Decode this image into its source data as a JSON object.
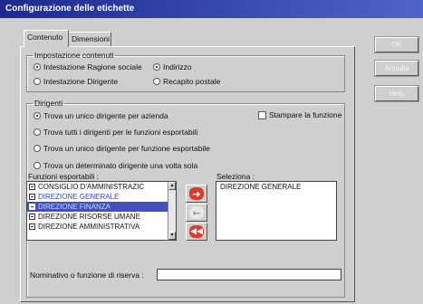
{
  "window": {
    "title": "Configurazione delle etichette"
  },
  "tabs": [
    {
      "label": "Contenuto"
    },
    {
      "label": "Dimensioni"
    }
  ],
  "impostazione": {
    "legend": "Impostazione contenuti",
    "options": [
      {
        "label": "Intestazione Ragione sociale",
        "checked": true
      },
      {
        "label": "Indirizzo",
        "checked": true
      },
      {
        "label": "Intestazione Dirigente",
        "checked": false
      },
      {
        "label": "Recapito postale",
        "checked": false
      }
    ]
  },
  "dirigenti": {
    "legend": "Dirigenti",
    "stampare_label": "Stampare la funzione",
    "stampare_checked": false,
    "options": [
      {
        "label": "Trova un unico dirigente per azienda",
        "checked": true
      },
      {
        "label": "Trova tutti i dirigenti per le funzioni esportabili",
        "checked": false
      },
      {
        "label": "Trova un unico dirigente per funzione esportabile",
        "checked": false
      },
      {
        "label": "Trova un determinato dirigente una volta sola",
        "checked": false
      }
    ],
    "funzioni_label": "Funzioni esportabili :",
    "funzioni_items": [
      {
        "label": "CONSIGLIO D'AMMINISTRAZIC",
        "state": "normal"
      },
      {
        "label": "DIREZIONE GENERALE",
        "state": "blue"
      },
      {
        "label": "DIREZIONE FINANZA",
        "state": "selected"
      },
      {
        "label": "DIREZIONE RISORSE UMANE",
        "state": "normal"
      },
      {
        "label": "DIREZIONE AMMINISTRATIVA",
        "state": "normal"
      }
    ],
    "seleziona_label": "Seleziona :",
    "seleziona_items": [
      {
        "label": "DIREZIONE GENERALE"
      }
    ],
    "nominativo_label": "Nominativo o funzione di riserva :",
    "nominativo_value": ""
  },
  "side_buttons": [
    {
      "label": "OK"
    },
    {
      "label": "Annulla"
    },
    {
      "label": "Help"
    }
  ],
  "colors": {
    "titlebar": "#1c2a8e",
    "selection": "#4050c0",
    "arrow_red": "#e23a2a"
  },
  "icons": {
    "add": "arrow-right-icon",
    "remove": "arrow-left-icon",
    "remove_all": "double-arrow-left-icon"
  }
}
